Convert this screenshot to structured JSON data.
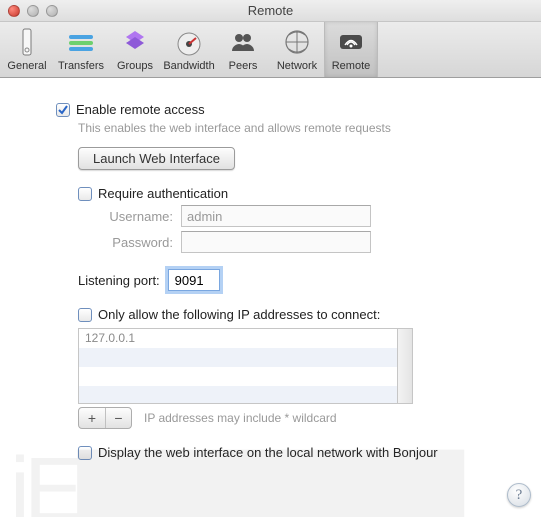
{
  "window": {
    "title": "Remote"
  },
  "toolbar": {
    "items": [
      {
        "label": "General"
      },
      {
        "label": "Transfers"
      },
      {
        "label": "Groups"
      },
      {
        "label": "Bandwidth"
      },
      {
        "label": "Peers"
      },
      {
        "label": "Network"
      },
      {
        "label": "Remote"
      }
    ],
    "selected": "Remote"
  },
  "remote": {
    "enable": {
      "label": "Enable remote access",
      "checked": true,
      "hint": "This enables the web interface and allows remote requests"
    },
    "launch_btn": "Launch Web Interface",
    "auth": {
      "require_label": "Require authentication",
      "require_checked": false,
      "username_label": "Username:",
      "username_value": "admin",
      "password_label": "Password:",
      "password_value": ""
    },
    "port": {
      "label": "Listening port:",
      "value": "9091",
      "focused": true
    },
    "ip": {
      "only_allow_label": "Only allow the following IP addresses to connect:",
      "only_allow_checked": false,
      "rows": [
        "127.0.0.1",
        "",
        "",
        ""
      ],
      "add_label": "+",
      "remove_label": "−",
      "wildcard_text": "IP addresses may include * wildcard"
    },
    "bonjour": {
      "label": "Display the web interface on the local network with Bonjour",
      "checked": false
    }
  },
  "help_char": "?"
}
